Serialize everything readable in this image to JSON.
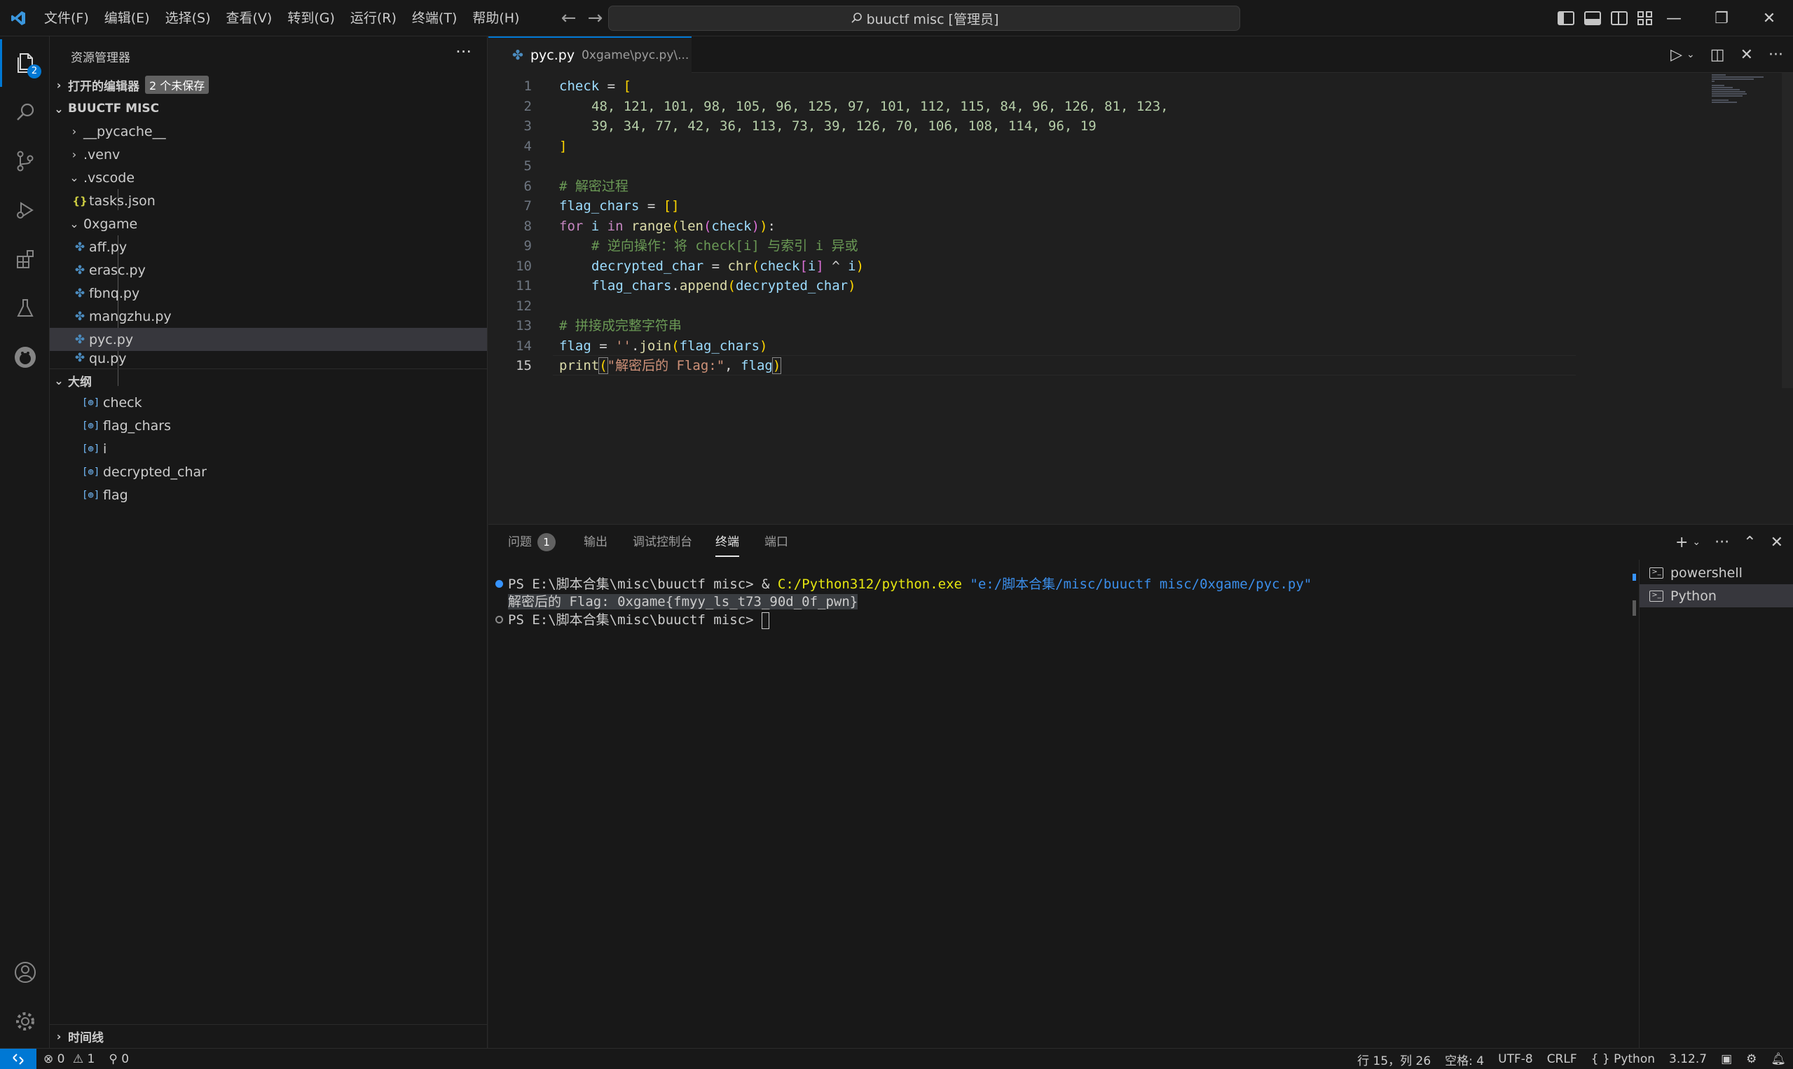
{
  "titlebar": {
    "menus": [
      "文件(F)",
      "编辑(E)",
      "选择(S)",
      "查看(V)",
      "转到(G)",
      "运行(R)",
      "终端(T)",
      "帮助(H)"
    ],
    "search_text": "buuctf misc [管理员]"
  },
  "sidebar": {
    "title": "资源管理器",
    "open_editors_label": "打开的编辑器",
    "unsaved_badge": "2 个未保存",
    "workspace_label": "BUUCTF MISC",
    "tree": [
      {
        "label": "__pycache__",
        "type": "folder",
        "collapsed": true
      },
      {
        "label": ".venv",
        "type": "folder",
        "collapsed": true
      },
      {
        "label": ".vscode",
        "type": "folder",
        "collapsed": false
      },
      {
        "label": "tasks.json",
        "type": "json"
      },
      {
        "label": "0xgame",
        "type": "folder",
        "collapsed": false
      },
      {
        "label": "aff.py",
        "type": "py"
      },
      {
        "label": "erasc.py",
        "type": "py"
      },
      {
        "label": "fbnq.py",
        "type": "py"
      },
      {
        "label": "mangzhu.py",
        "type": "py"
      },
      {
        "label": "pyc.py",
        "type": "py",
        "selected": true
      },
      {
        "label": "qu.py",
        "type": "py"
      }
    ],
    "outline_label": "大纲",
    "outline": [
      "check",
      "flag_chars",
      "i",
      "decrypted_char",
      "flag"
    ],
    "timeline_label": "时间线"
  },
  "activitybar": {
    "explorer_badge": "2",
    "icons": [
      "explorer-icon",
      "search-icon",
      "source-control-icon",
      "run-debug-icon",
      "extensions-icon",
      "testing-icon",
      "remote-icon",
      "account-icon",
      "settings-gear-icon"
    ]
  },
  "editor": {
    "tab_name": "pyc.py",
    "tab_desc": "0xgame\\pyc.py\\...",
    "line_numbers": [
      "1",
      "2",
      "3",
      "4",
      "5",
      "6",
      "7",
      "8",
      "9",
      "10",
      "11",
      "12",
      "13",
      "14",
      "15"
    ],
    "current_line": 15,
    "code": {
      "l1_var": "check",
      "l1_rest": " = ",
      "l1_br": "[",
      "l2": "48, 121, 101, 98, 105, 96, 125, 97, 101, 112, 115, 84, 96, 126, 81, 123,",
      "l3": "39, 34, 77, 42, 36, 113, 73, 39, 126, 70, 106, 108, 114, 96, 19",
      "l4": "]",
      "l6": "# 解密过程",
      "l7_var": "flag_chars",
      "l7_op": " = ",
      "l7_br": "[]",
      "l8_kw1": "for",
      "l8_var": " i ",
      "l8_kw2": "in",
      "l8_fn1": " range",
      "l8_fn2": "len",
      "l8_arg": "check",
      "l8_end": ":",
      "l9": "# 逆向操作：将 check[i] 与索引 i 异或",
      "l10_var": "decrypted_char",
      "l10_op": " = ",
      "l10_fn": "chr",
      "l10_arg1": "check",
      "l10_arg2": "i",
      "l10_op2": " ^ ",
      "l10_arg3": "i",
      "l11_var": "flag_chars",
      "l11_fn": "append",
      "l11_arg": "decrypted_char",
      "l13": "# 拼接成完整字符串",
      "l14_var": "flag",
      "l14_op": " = ",
      "l14_str": "''",
      "l14_fn": "join",
      "l14_arg": "flag_chars",
      "l15_fn": "print",
      "l15_str": "\"解密后的 Flag:\"",
      "l15_sep": ", ",
      "l15_arg": "flag"
    }
  },
  "panel": {
    "tabs": [
      "问题",
      "输出",
      "调试控制台",
      "终端",
      "端口"
    ],
    "problems_count": "1",
    "terminal": {
      "prompt1": "PS E:\\脚本合集\\misc\\buuctf misc> ",
      "amp": "& ",
      "exe": "C:/Python312/python.exe",
      "arg": " \"e:/脚本合集/misc/buuctf misc/0xgame/pyc.py\"",
      "output_label": "解密后的 Flag: ",
      "output_flag": "0xgame{fmyy_ls_t73_90d_0f_pwn}",
      "prompt2": "PS E:\\脚本合集\\misc\\buuctf misc> "
    },
    "terminals": [
      "powershell",
      "Python"
    ]
  },
  "statusbar": {
    "errors": "0",
    "warnings": "1",
    "ports": "0",
    "cursor_pos": "行 15，列 26",
    "spaces": "空格: 4",
    "encoding": "UTF-8",
    "eol": "CRLF",
    "language": "Python",
    "python_version": "3.12.7"
  },
  "colors": {
    "accent": "#0078d4",
    "background": "#1f1f1f",
    "chrome": "#181818"
  }
}
